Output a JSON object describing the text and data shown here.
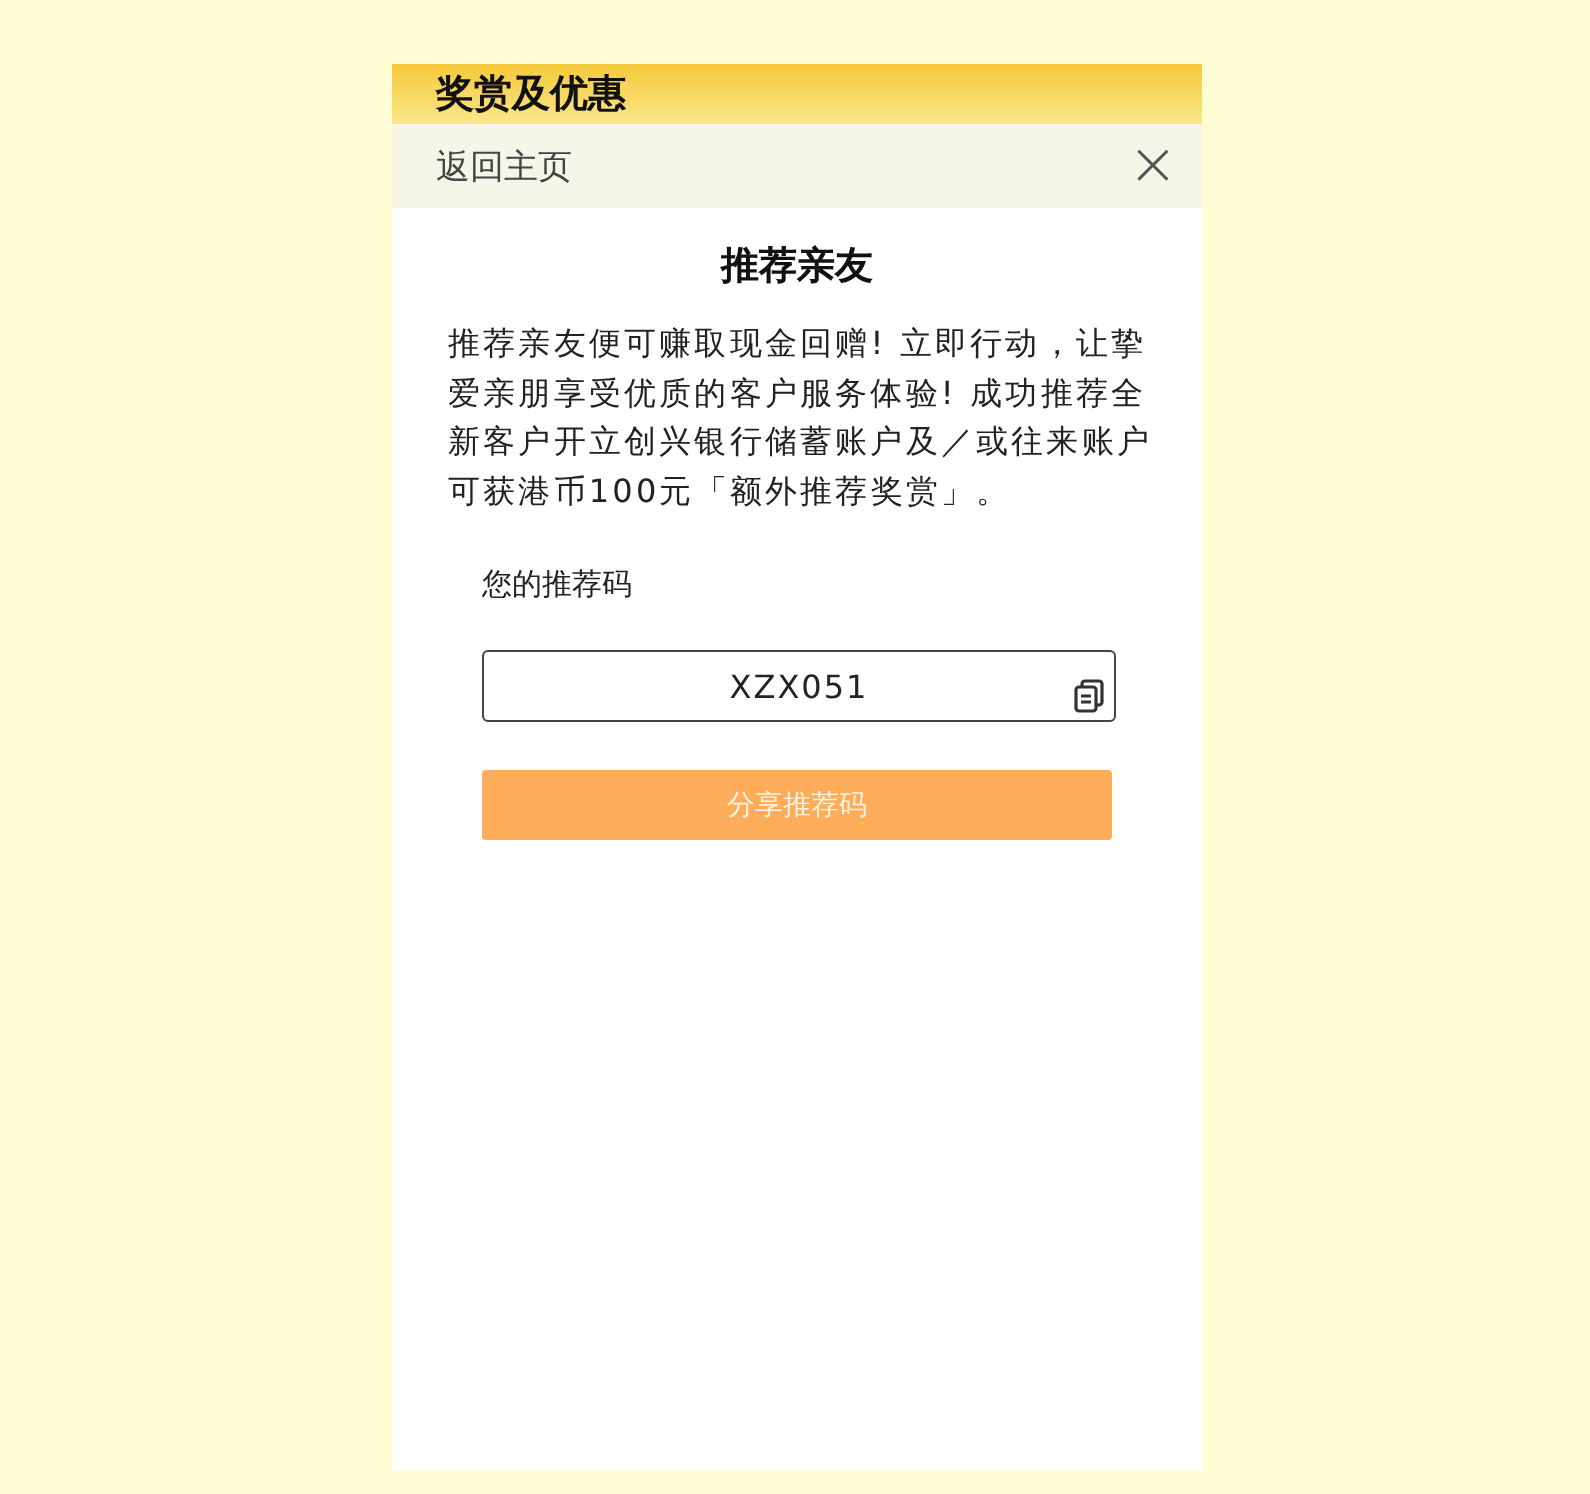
{
  "header": {
    "title": "奖赏及优惠"
  },
  "nav": {
    "back": "返回主页",
    "close": "×"
  },
  "content": {
    "heading": "推荐亲友",
    "description": "推荐亲友便可赚取现金回赠! 立即行动，让挚爱亲朋享受优质的客户服务体验! 成功推荐全新客户开立创兴银行储蓄账户及／或往来账户可获港币100元「额外推荐奖赏」。",
    "code_label": "您的推荐码",
    "code_value": "XZX051",
    "share_button": "分享推荐码"
  }
}
